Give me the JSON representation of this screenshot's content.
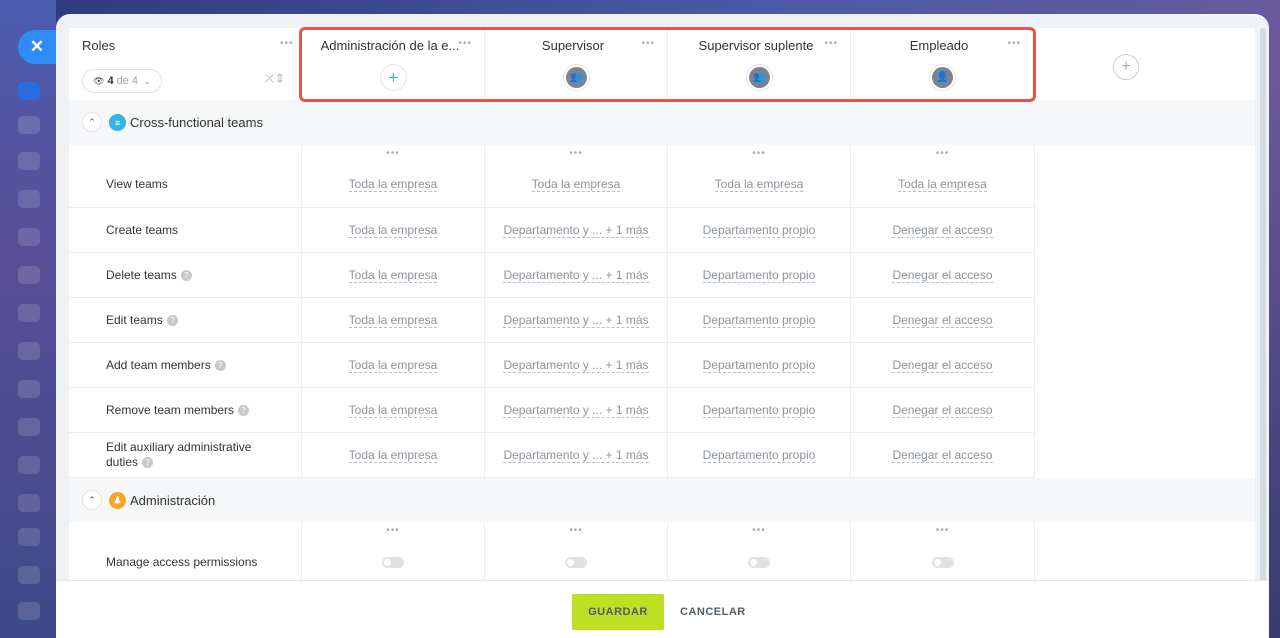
{
  "header": {
    "roles_title": "Roles",
    "filter_count": "4",
    "filter_total": "de 4",
    "columns": [
      {
        "title": "Administración de la e...",
        "icon": "plus-icon"
      },
      {
        "title": "Supervisor",
        "icon": "group-icon"
      },
      {
        "title": "Supervisor suplente",
        "icon": "group-icon"
      },
      {
        "title": "Empleado",
        "icon": "user-icon"
      }
    ]
  },
  "sections": [
    {
      "label": "Cross-functional teams",
      "color": "#2fb5e6",
      "rows": [
        {
          "label": "View teams",
          "values": [
            "Toda la empresa",
            "Toda la empresa",
            "Toda la empresa",
            "Toda la empresa"
          ]
        },
        {
          "label": "Create teams",
          "values": [
            "Toda la empresa",
            "Departamento y ... + 1 más",
            "Departamento propio",
            "Denegar el acceso"
          ]
        },
        {
          "label": "Delete teams",
          "values": [
            "Toda la empresa",
            "Departamento y ... + 1 más",
            "Departamento propio",
            "Denegar el acceso"
          ]
        },
        {
          "label": "Edit teams",
          "values": [
            "Toda la empresa",
            "Departamento y ... + 1 más",
            "Departamento propio",
            "Denegar el acceso"
          ]
        },
        {
          "label": "Add team members",
          "values": [
            "Toda la empresa",
            "Departamento y ... + 1 más",
            "Departamento propio",
            "Denegar el acceso"
          ]
        },
        {
          "label": "Remove team members",
          "values": [
            "Toda la empresa",
            "Departamento y ... + 1 más",
            "Departamento propio",
            "Denegar el acceso"
          ]
        },
        {
          "label": "Edit auxiliary administrative duties",
          "values": [
            "Toda la empresa",
            "Departamento y ... + 1 más",
            "Departamento propio",
            "Denegar el acceso"
          ]
        }
      ]
    },
    {
      "label": "Administración",
      "color": "#f5a623",
      "rows": [
        {
          "label": "Manage access permissions"
        }
      ]
    }
  ],
  "footer": {
    "save_label": "GUARDAR",
    "cancel_label": "CANCELAR"
  }
}
